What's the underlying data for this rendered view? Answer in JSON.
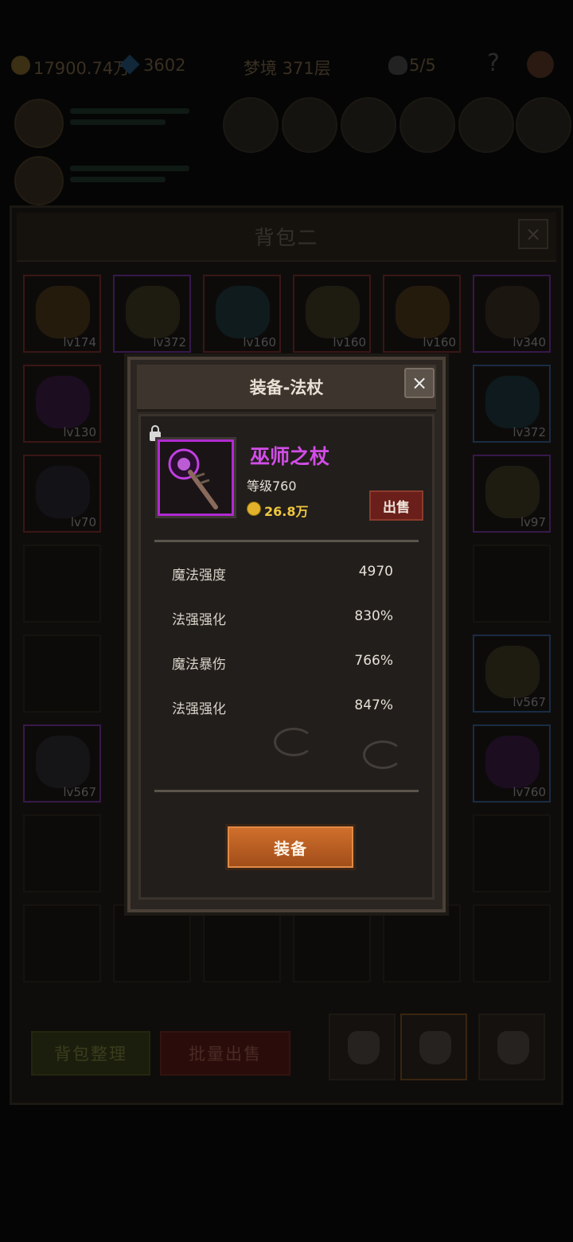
{
  "hud": {
    "gold": "17900.74万",
    "gems": "3602",
    "stage": "梦境 371层",
    "lives": "5/5",
    "help": "?"
  },
  "bag": {
    "title": "背包二",
    "close": "×",
    "slots_row1": [
      "lv174",
      "lv372",
      "lv160",
      "lv160",
      "lv160",
      "lv340"
    ],
    "slots_side": [
      "lv130",
      "lv372",
      "lv70",
      "lv97",
      "lv567",
      "lv567",
      "lv760"
    ],
    "sort_button": "背包整理",
    "bulk_sell_button": "批量出售"
  },
  "modal": {
    "title": "装备-法杖",
    "close": "×",
    "item": {
      "name": "巫师之杖",
      "level": "等级760",
      "price": "26.8万",
      "sell_button": "出售"
    },
    "stats": [
      {
        "label": "魔法强度",
        "value": "4970"
      },
      {
        "label": "法强强化",
        "value": "830%"
      },
      {
        "label": "魔法暴伤",
        "value": "766%"
      },
      {
        "label": "法强强化",
        "value": "847%"
      }
    ],
    "equip_button": "装备"
  },
  "colors": {
    "accent_purple": "#d24de8",
    "price_gold": "#f0c640",
    "equip_orange": "#cf6f2c",
    "sell_red": "#6b1f1a"
  }
}
